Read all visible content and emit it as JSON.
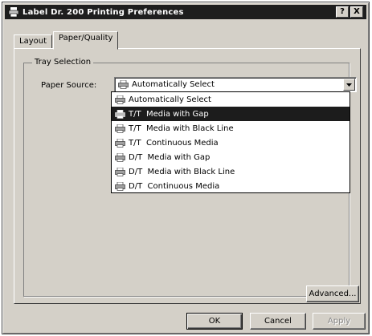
{
  "window": {
    "title": "Label Dr. 200 Printing Preferences",
    "help_label": "?",
    "close_label": "X"
  },
  "tabs": [
    {
      "label": "Layout",
      "active": false
    },
    {
      "label": "Paper/Quality",
      "active": true
    }
  ],
  "tray_selection": {
    "group_label": "Tray Selection",
    "paper_source_label": "Paper Source:",
    "selected_value": "Automatically Select",
    "options": [
      {
        "label": "Automatically Select",
        "icon": "printer-icon",
        "selected": false
      },
      {
        "label": "T/T  Media with Gap",
        "icon": "printer-icon",
        "selected": true
      },
      {
        "label": "T/T  Media with Black Line",
        "icon": "printer-icon",
        "selected": false
      },
      {
        "label": "T/T  Continuous Media",
        "icon": "printer-icon",
        "selected": false
      },
      {
        "label": "D/T  Media with Gap",
        "icon": "printer-icon",
        "selected": false
      },
      {
        "label": "D/T  Media with Black Line",
        "icon": "printer-icon",
        "selected": false
      },
      {
        "label": "D/T  Continuous Media",
        "icon": "printer-icon",
        "selected": false
      }
    ]
  },
  "buttons": {
    "advanced": "Advanced...",
    "ok": "OK",
    "cancel": "Cancel",
    "apply": "Apply"
  },
  "colors": {
    "dialog_face": "#d4d0c8",
    "title_bar": "#1e1e1e",
    "selection": "#1c1c1c"
  }
}
